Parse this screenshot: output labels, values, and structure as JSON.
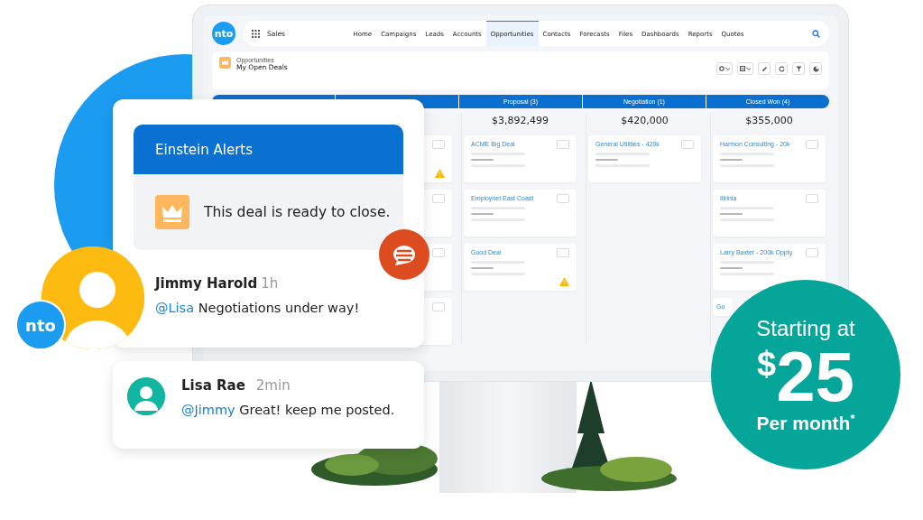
{
  "app": {
    "logo": "nto",
    "name": "Sales"
  },
  "nav": [
    {
      "label": "Home",
      "selected": false
    },
    {
      "label": "Campaigns",
      "selected": false
    },
    {
      "label": "Leads",
      "selected": false
    },
    {
      "label": "Accounts",
      "selected": false
    },
    {
      "label": "Opportunities",
      "selected": true
    },
    {
      "label": "Contacts",
      "selected": false
    },
    {
      "label": "Forecasts",
      "selected": false
    },
    {
      "label": "Files",
      "selected": false
    },
    {
      "label": "Dashboards",
      "selected": false
    },
    {
      "label": "Reports",
      "selected": false
    },
    {
      "label": "Quotes",
      "selected": false
    }
  ],
  "list_header": {
    "object": "Opportunities",
    "title": "My Open Deals"
  },
  "path": [
    {
      "label": "Proposal (3)"
    },
    {
      "label": "Negotiation (1)"
    },
    {
      "label": "Closed Won (4)"
    }
  ],
  "columns": [
    {
      "cards": [
        {
          "warning": true
        },
        {
          "warning": false
        },
        {
          "warning": false
        },
        {
          "warning": false
        }
      ]
    },
    {
      "total": "$3,892,499",
      "cards": [
        {
          "title": "ACME Big Deal",
          "warning": false
        },
        {
          "title": "Employnet East Coast",
          "warning": false
        },
        {
          "title": "Good Deal",
          "warning": true
        }
      ]
    },
    {
      "total": "$420,000",
      "cards": [
        {
          "title": "General Utilities - 420k",
          "warning": false
        }
      ]
    },
    {
      "total": "$355,000",
      "cards": [
        {
          "title": "Harmon Consulting - 20k",
          "warning": false
        },
        {
          "title": "Illrinia",
          "warning": false
        },
        {
          "title": "Larry Baxter - 200k Oppty",
          "warning": false
        },
        {
          "title": "Gu",
          "warning": false
        }
      ]
    }
  ],
  "alert": {
    "title": "Einstein Alerts",
    "message": "This deal is ready to close."
  },
  "comments": [
    {
      "author": "Jimmy Harold",
      "time": "1h",
      "mention": "@Lisa",
      "text": "Negotiations under way!"
    },
    {
      "author": "Lisa Rae",
      "time": "2min",
      "mention": "@Jimmy",
      "text": "Great! keep me posted."
    }
  ],
  "badge": {
    "logo": "nto"
  },
  "offer": {
    "intro": "Starting at",
    "currency": "$",
    "amount": "25",
    "period": "Per month$^{*}$"
  }
}
